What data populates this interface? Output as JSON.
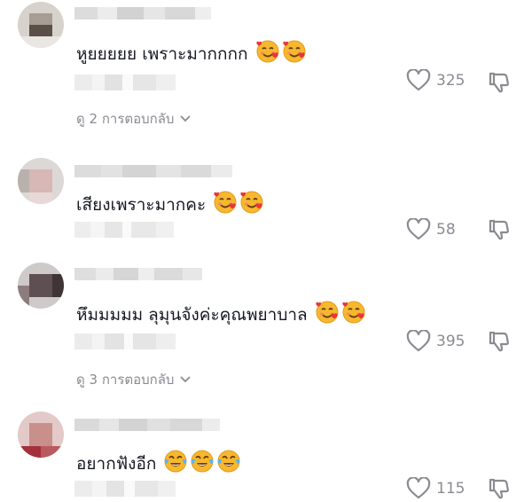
{
  "comments": [
    {
      "text": "หูยยยยย เพราะมากกกก",
      "emoji": [
        "smiling-face-with-hearts",
        "smiling-face-with-hearts"
      ],
      "likes": "325",
      "replies_label": "ดู 2 การตอบกลับ"
    },
    {
      "text": "เสียงเพราะมากคะ",
      "emoji": [
        "smiling-face-with-hearts",
        "smiling-face-with-hearts"
      ],
      "likes": "58",
      "replies_label": ""
    },
    {
      "text": "หึมมมมม ลุมุนจังค่ะคุณพยาบาล",
      "emoji": [
        "smiling-face-with-hearts",
        "smiling-face-with-hearts"
      ],
      "likes": "395",
      "replies_label": "ดู 3 การตอบกลับ"
    },
    {
      "text": "อยากฟังอีก",
      "emoji": [
        "tears-of-joy",
        "tears-of-joy",
        "tears-of-joy"
      ],
      "likes": "115",
      "replies_label": ""
    }
  ],
  "colors": {
    "text": "#161823",
    "secondary": "#8a8b91",
    "pixel_light": "#ececec",
    "pixel_mid": "#d9d9d9"
  }
}
